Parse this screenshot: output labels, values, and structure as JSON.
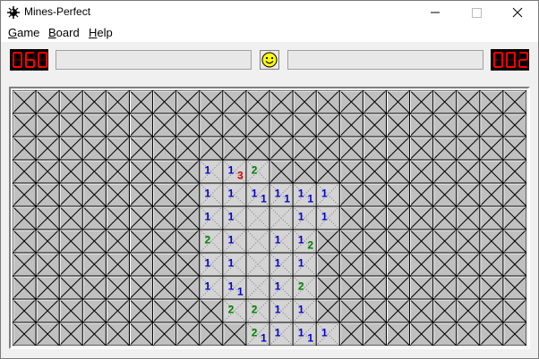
{
  "window": {
    "title": "Mines-Perfect",
    "controls": [
      "minimize",
      "maximize",
      "close"
    ]
  },
  "menu": [
    {
      "label": "Game",
      "accel": "G",
      "rest": "ame"
    },
    {
      "label": "Board",
      "accel": "B",
      "rest": "oard"
    },
    {
      "label": "Help",
      "accel": "H",
      "rest": "elp"
    }
  ],
  "counters": {
    "mines_left": "060",
    "time": "002"
  },
  "face": "smiley-face-icon",
  "board": {
    "rows": 11,
    "cols": 22,
    "tile_shape": "triangle",
    "opened": [
      {
        "r": 3,
        "c": 8,
        "v": 1
      },
      {
        "r": 3,
        "c": 9,
        "v": 1
      },
      {
        "r": 3,
        "c": 9,
        "v": 3,
        "half": "r"
      },
      {
        "r": 3,
        "c": 10,
        "v": 2
      },
      {
        "r": 4,
        "c": 8,
        "v": 1
      },
      {
        "r": 4,
        "c": 9,
        "v": 1
      },
      {
        "r": 4,
        "c": 10,
        "v": 1
      },
      {
        "r": 4,
        "c": 10,
        "v": 1,
        "half": "r"
      },
      {
        "r": 4,
        "c": 11,
        "v": 1
      },
      {
        "r": 4,
        "c": 11,
        "v": 1,
        "half": "r"
      },
      {
        "r": 4,
        "c": 12,
        "v": 1
      },
      {
        "r": 4,
        "c": 12,
        "v": 1,
        "half": "r"
      },
      {
        "r": 4,
        "c": 13,
        "v": 1
      },
      {
        "r": 5,
        "c": 8,
        "v": 1
      },
      {
        "r": 5,
        "c": 9,
        "v": 1
      },
      {
        "r": 5,
        "c": 10,
        "v": 0
      },
      {
        "r": 5,
        "c": 11,
        "v": 0
      },
      {
        "r": 5,
        "c": 12,
        "v": 1
      },
      {
        "r": 5,
        "c": 13,
        "v": 1
      },
      {
        "r": 6,
        "c": 8,
        "v": 2
      },
      {
        "r": 6,
        "c": 9,
        "v": 1
      },
      {
        "r": 6,
        "c": 10,
        "v": 0
      },
      {
        "r": 6,
        "c": 11,
        "v": 1
      },
      {
        "r": 6,
        "c": 12,
        "v": 1
      },
      {
        "r": 6,
        "c": 12,
        "v": 2,
        "half": "r"
      },
      {
        "r": 7,
        "c": 8,
        "v": 1
      },
      {
        "r": 7,
        "c": 9,
        "v": 1
      },
      {
        "r": 7,
        "c": 10,
        "v": 0
      },
      {
        "r": 7,
        "c": 11,
        "v": 1
      },
      {
        "r": 7,
        "c": 12,
        "v": 1
      },
      {
        "r": 8,
        "c": 8,
        "v": 1
      },
      {
        "r": 8,
        "c": 9,
        "v": 1
      },
      {
        "r": 8,
        "c": 9,
        "v": 1,
        "half": "r"
      },
      {
        "r": 8,
        "c": 10,
        "v": 0
      },
      {
        "r": 8,
        "c": 11,
        "v": 1
      },
      {
        "r": 8,
        "c": 12,
        "v": 2
      },
      {
        "r": 9,
        "c": 9,
        "v": 2
      },
      {
        "r": 9,
        "c": 10,
        "v": 2
      },
      {
        "r": 9,
        "c": 11,
        "v": 1
      },
      {
        "r": 9,
        "c": 12,
        "v": 1
      },
      {
        "r": 10,
        "c": 10,
        "v": 2
      },
      {
        "r": 10,
        "c": 10,
        "v": 1,
        "half": "r"
      },
      {
        "r": 10,
        "c": 11,
        "v": 1
      },
      {
        "r": 10,
        "c": 12,
        "v": 1
      },
      {
        "r": 10,
        "c": 12,
        "v": 1,
        "half": "r"
      },
      {
        "r": 10,
        "c": 13,
        "v": 1
      }
    ],
    "number_colors": {
      "1": "#0000d0",
      "2": "#008000",
      "3": "#e00000"
    }
  }
}
